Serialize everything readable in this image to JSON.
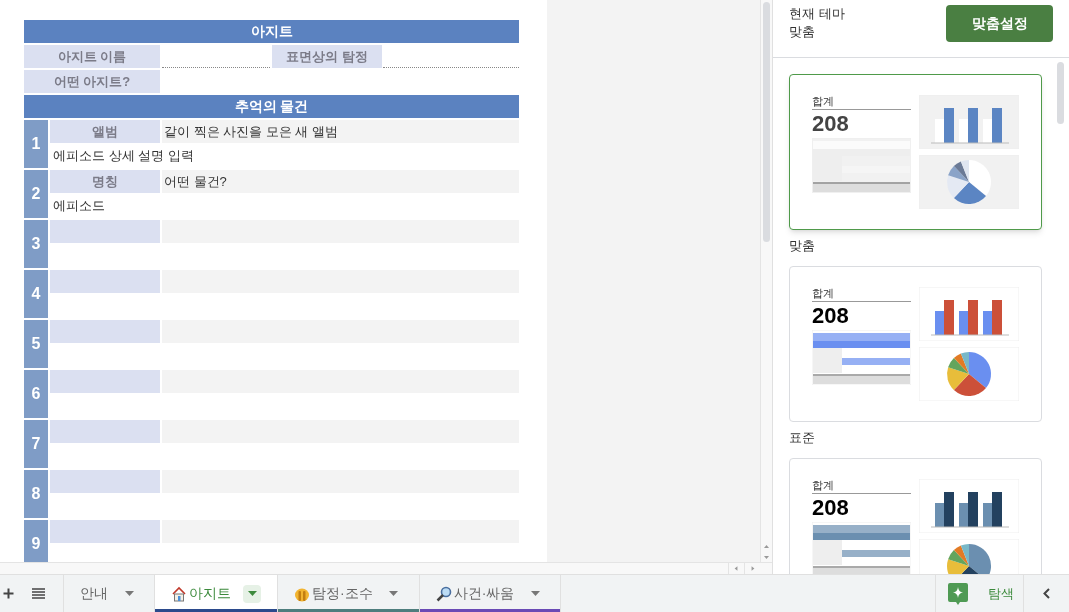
{
  "sheet": {
    "title": "아지트",
    "fields": [
      {
        "label": "아지트 이름"
      },
      {
        "label": "표면상의 탐정"
      },
      {
        "label": "어떤 아지트?"
      }
    ],
    "section_title": "추억의 물건",
    "items": [
      {
        "number": "1",
        "label": "앨범",
        "value": "같이 찍은 사진을 모은 새 앨범",
        "description": "에피소드 상세 설명 입력"
      },
      {
        "number": "2",
        "label": "명칭",
        "value": "어떤 물건?",
        "description": "에피소드"
      },
      {
        "number": "3"
      },
      {
        "number": "4"
      },
      {
        "number": "5"
      },
      {
        "number": "6"
      },
      {
        "number": "7"
      },
      {
        "number": "8"
      },
      {
        "number": "9"
      }
    ]
  },
  "theme_panel": {
    "current_label": "현재 테마",
    "current_theme": "맞춤",
    "customize_button": "맞춤설정",
    "themes": [
      {
        "name": "맞춤",
        "selected": true,
        "stat_label": "합계",
        "stat_value": "208"
      },
      {
        "name": "표준",
        "selected": false,
        "stat_label": "합계",
        "stat_value": "208"
      },
      {
        "selected": false,
        "stat_label": "합계",
        "stat_value": "208"
      }
    ]
  },
  "sheet_tabs": [
    {
      "label": "안내",
      "selected": false
    },
    {
      "label": "아지트",
      "selected": true,
      "color": "#2b4a8c"
    },
    {
      "label": "탐정·조수",
      "selected": false,
      "color": "#4e7d7d"
    },
    {
      "label": "사건·싸움",
      "selected": false,
      "color": "#6a4ab5"
    }
  ],
  "explore_button": "탐색"
}
